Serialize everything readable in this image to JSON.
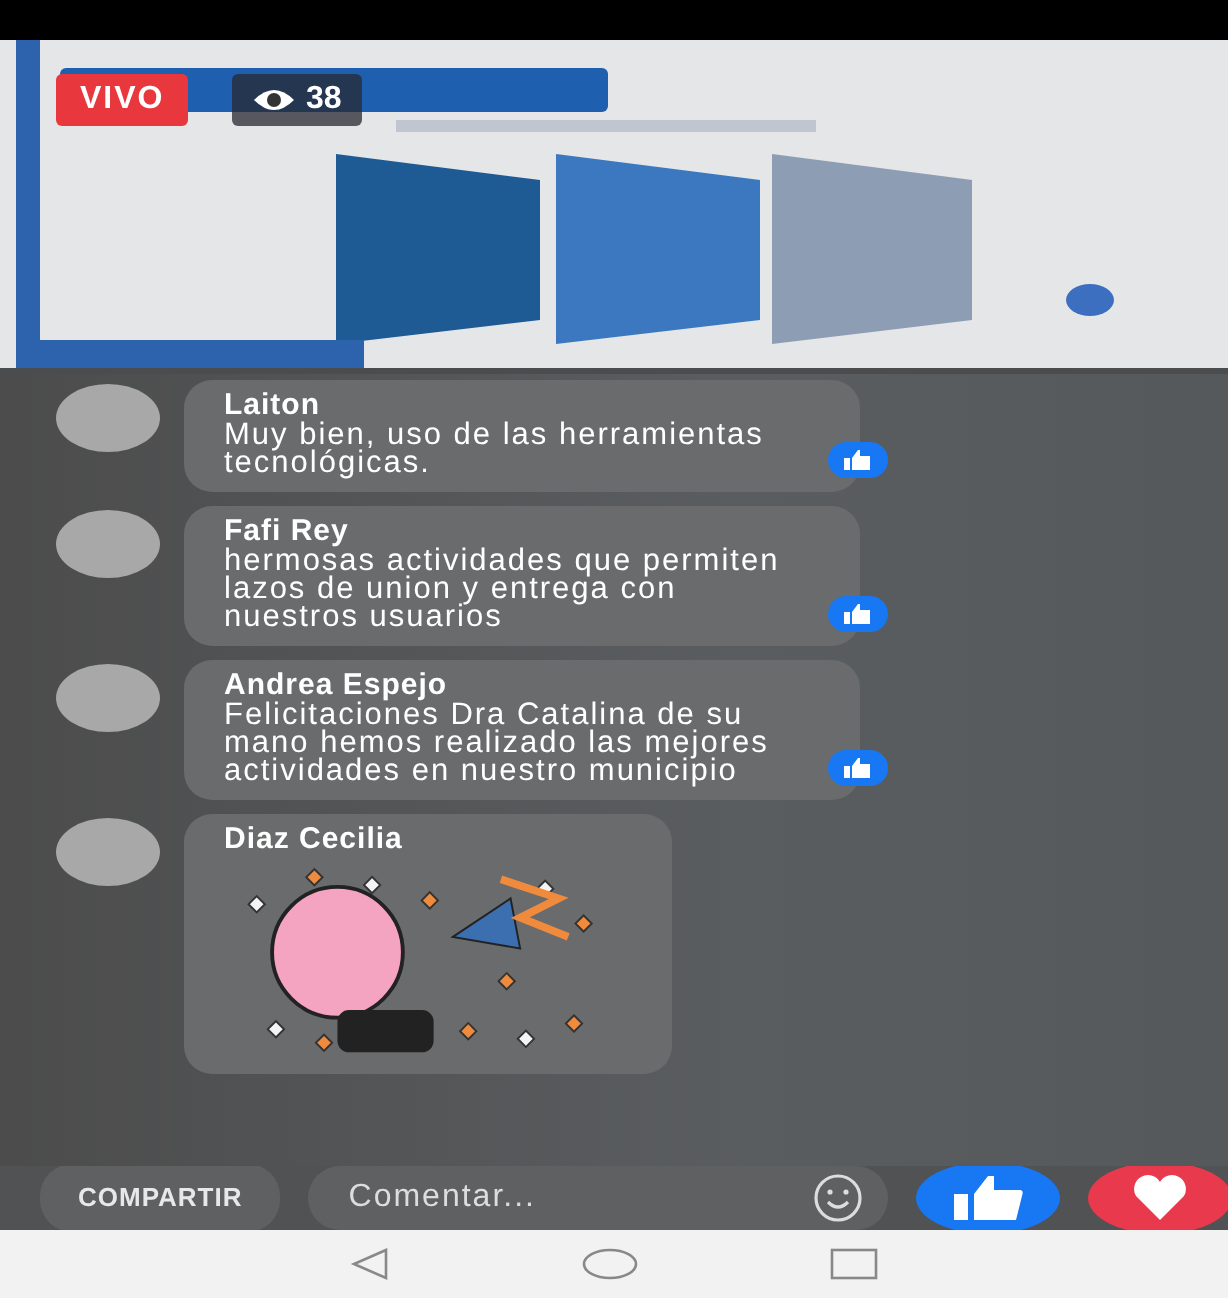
{
  "video": {
    "kind": "picture",
    "live_badge": "VIVO",
    "viewer_count": "38"
  },
  "comments": [
    {
      "kind": "text",
      "author": "Laiton",
      "text": "Muy bien, uso de las herramientas tecnológicas."
    },
    {
      "kind": "text",
      "author": "Fafi Rey",
      "text": "hermosas actividades que permiten lazos de union y entrega con nuestros usuarios"
    },
    {
      "kind": "text",
      "author": "Andrea Espejo",
      "text": "Felicitaciones Dra Catalina de su mano hemos realizado las mejores actividades en nuestro municipio"
    },
    {
      "kind": "sticker",
      "author": "Diaz Cecilia"
    }
  ],
  "actions": {
    "share": "COMPARTIR",
    "comment_placeholder": "Comentar..."
  }
}
